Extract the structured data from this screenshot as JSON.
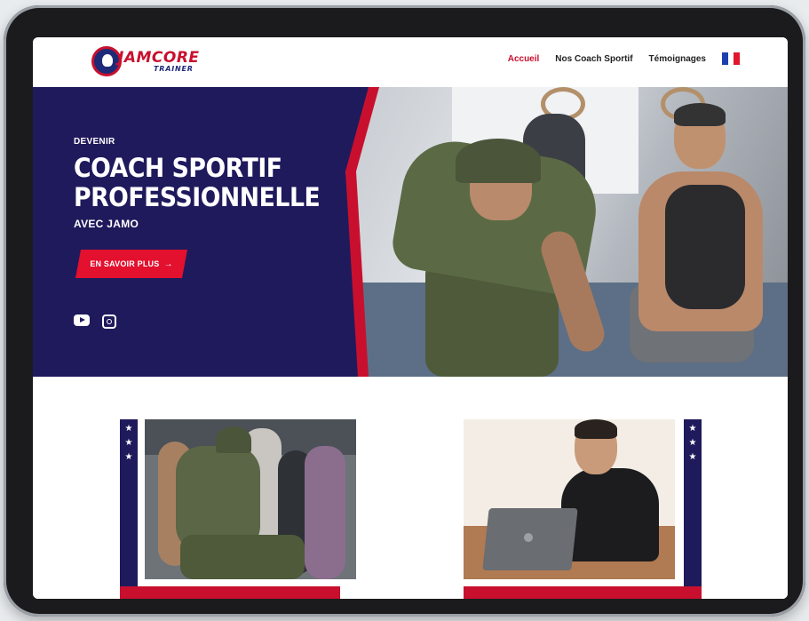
{
  "header": {
    "logo_text": "JAMCORE",
    "logo_sub": "TRAINER",
    "nav": [
      {
        "label": "Accueil",
        "active": true
      },
      {
        "label": "Nos Coach Sportif",
        "active": false
      },
      {
        "label": "Témoignages",
        "active": false
      }
    ],
    "language_flag": "french-flag-icon"
  },
  "hero": {
    "eyebrow": "DEVENIR",
    "title_line1": "COACH SPORTIF",
    "title_line2": "PROFESSIONNELLE",
    "subtitle": "AVEC JAMO",
    "cta_label": "EN SAVOIR PLUS",
    "socials": [
      "youtube-icon",
      "instagram-icon"
    ]
  },
  "colors": {
    "navy": "#1f1a5c",
    "red": "#c8102e",
    "accent": "#e3102e"
  }
}
